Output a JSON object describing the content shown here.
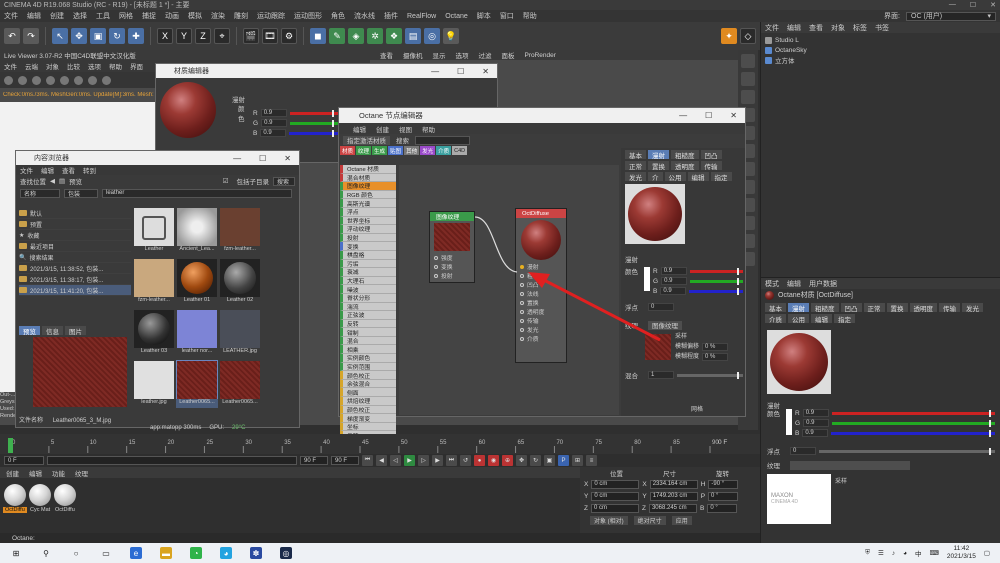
{
  "titlebar": {
    "title": "CINEMA 4D R19.068 Studio (RC - R19) - [未标题 1 *] - 主要"
  },
  "menu": {
    "items": [
      "文件",
      "编辑",
      "创建",
      "选择",
      "工具",
      "网格",
      "捕捉",
      "动画",
      "模拟",
      "渲染",
      "雕刻",
      "运动跟踪",
      "运动图形",
      "角色",
      "流水线",
      "插件",
      "RealFlow",
      "Octane",
      "脚本",
      "窗口",
      "帮助"
    ],
    "layout_label": "界面:",
    "layout_value": "OC (用户)"
  },
  "toolbar": {
    "axis_x": "X",
    "axis_y": "Y",
    "axis_z": "Z"
  },
  "object_manager": {
    "tabs": [
      "文件",
      "编辑",
      "查看",
      "对象",
      "标签",
      "书签"
    ],
    "items": [
      {
        "name": "Studio L",
        "color": "#9a9a9a"
      },
      {
        "name": "OctaneSky",
        "color": "#5a8ad0"
      },
      {
        "name": "立方体",
        "color": "#5a8ad0"
      }
    ]
  },
  "live_viewer": {
    "title": "Live Viewer 3.07-R2 中国C4D联盟中文汉化版",
    "menu": [
      "文件",
      "云端",
      "对象",
      "比较",
      "选项",
      "帮助",
      "界面"
    ],
    "status": "Check:0ms./3ms. MeshGen:0ms. Update[M]:3ms. Mesh:"
  },
  "viewport_menu": [
    "查看",
    "摄像机",
    "显示",
    "选项",
    "过滤",
    "面板",
    "ProRender"
  ],
  "side_labels": [
    "Out-...",
    "Greys...",
    "Used:...",
    "Render"
  ],
  "material_editor": {
    "title": "材质编辑器",
    "section": "漫射",
    "color_label": "颜色",
    "rows": [
      {
        "ch": "R",
        "val": "0.9"
      },
      {
        "ch": "G",
        "val": "0.9"
      },
      {
        "ch": "B",
        "val": "0.9"
      }
    ]
  },
  "content_browser": {
    "title": "内容浏览器",
    "menu": [
      "文件",
      "编辑",
      "查看",
      "转到"
    ],
    "find_label": "查找位置",
    "preview_label": "预览",
    "search_value": "leather",
    "filter_a": "名称",
    "filter_b": "包装",
    "include_sub": "包括子目录",
    "search_btn": "搜索",
    "tree": [
      "默认",
      "预置",
      "收藏",
      "最近项目",
      "搜索结果",
      "2021/3/15, 11:38:52, 包装...",
      "2021/3/15, 11:38:17, 包装...",
      "2021/3/15, 11:41:20, 包装..."
    ],
    "thumbs": [
      {
        "label": "Leather"
      },
      {
        "label": "Ancient_Lea..."
      },
      {
        "label": "fzm-leather..."
      },
      {
        "label": "fzm-leather..."
      },
      {
        "label": "Leather 01"
      },
      {
        "label": "Leather 02"
      },
      {
        "label": "Leather 03"
      },
      {
        "label": "leather nor..."
      },
      {
        "label": "LEATHER.jpg"
      },
      {
        "label": "leather.jpg"
      },
      {
        "label": "Leather0065..."
      },
      {
        "label": "Leather0065..."
      }
    ],
    "preview_tabs": [
      "预览",
      "信息",
      "图片"
    ],
    "file_name_label": "文件名称",
    "file_name": "Leather0065_3_M.jpg"
  },
  "octane_node": {
    "title": "Octane 节点编辑器",
    "menu": [
      "编辑",
      "创建",
      "视图",
      "帮助"
    ],
    "assign_btn": "指定激活材质",
    "search_label": "搜索",
    "color_tabs": [
      {
        "label": "材质",
        "color": "#c44"
      },
      {
        "label": "纹理",
        "color": "#3a9a4a"
      },
      {
        "label": "生成",
        "color": "#3a9a4a"
      },
      {
        "label": "贴图",
        "color": "#4a70c9"
      },
      {
        "label": "其他",
        "color": "#777"
      },
      {
        "label": "发光",
        "color": "#9a4ac9"
      },
      {
        "label": "介质",
        "color": "#3aa0a0"
      },
      {
        "label": "C4D",
        "color": "#aaa"
      }
    ],
    "node_list": [
      {
        "label": "Octane 材质",
        "kind": "red"
      },
      {
        "label": "混合材质",
        "kind": "red"
      },
      {
        "label": "图像纹理",
        "kind": "sel"
      },
      {
        "label": "RGB 颜色",
        "kind": "green"
      },
      {
        "label": "高斯光谱",
        "kind": "green"
      },
      {
        "label": "浮点",
        "kind": "green"
      },
      {
        "label": "世界坐标",
        "kind": "green"
      },
      {
        "label": "浮动纹理",
        "kind": "green"
      },
      {
        "label": "投射",
        "kind": "green"
      },
      {
        "label": "变换",
        "kind": "blue"
      },
      {
        "label": "棋盘格",
        "kind": "green"
      },
      {
        "label": "污垢",
        "kind": "green"
      },
      {
        "label": "衰减",
        "kind": "green"
      },
      {
        "label": "大理石",
        "kind": "green"
      },
      {
        "label": "噪波",
        "kind": "green"
      },
      {
        "label": "脊状分形",
        "kind": "green"
      },
      {
        "label": "湍流",
        "kind": "green"
      },
      {
        "label": "正弦波",
        "kind": "green"
      },
      {
        "label": "反转",
        "kind": "green"
      },
      {
        "label": "钳制",
        "kind": "green"
      },
      {
        "label": "混合",
        "kind": "green"
      },
      {
        "label": "相乘",
        "kind": "green"
      },
      {
        "label": "实例颜色",
        "kind": "green"
      },
      {
        "label": "实例范围",
        "kind": "green"
      },
      {
        "label": "颜色校正",
        "kind": "yellow"
      },
      {
        "label": "余弦混合",
        "kind": "yellow"
      },
      {
        "label": "侧面",
        "kind": "yellow"
      },
      {
        "label": "烘焙纹理",
        "kind": "yellow"
      },
      {
        "label": "颜色校正",
        "kind": "yellow"
      },
      {
        "label": "梯度渐变",
        "kind": "yellow"
      },
      {
        "label": "坐标",
        "kind": "yellow"
      },
      {
        "label": "反转",
        "kind": "yellow"
      }
    ],
    "image_node": {
      "title": "图像纹理",
      "pins": [
        "强度",
        "变换",
        "投射"
      ]
    },
    "diffuse_node": {
      "title": "OctDiffuse",
      "pins": [
        "漫射",
        "粗糙",
        "凹凸",
        "法线",
        "置换",
        "透明度",
        "传输",
        "发光",
        "介质"
      ]
    },
    "prop_tabs": [
      "基本",
      "漫射",
      "粗糙度",
      "凹凸",
      "正常",
      "置换",
      "透明度",
      "传输",
      "发光",
      "介",
      "公用",
      "编辑",
      "指定"
    ],
    "prop_section": "漫射",
    "prop_color": "颜色",
    "prop_rows": [
      {
        "ch": "R",
        "val": "0.9"
      },
      {
        "ch": "G",
        "val": "0.9"
      },
      {
        "ch": "B",
        "val": "0.9"
      }
    ],
    "float_label": "浮点",
    "float_val": "0",
    "tex_label": "纹理",
    "tex_btn": "图像纹理",
    "tex_sample": "采样",
    "blur_a_label": "模糊偏移",
    "blur_a_val": "0 %",
    "blur_b_label": "模糊程度",
    "blur_b_val": "0 %",
    "mix_label": "混合",
    "mix_val": "1",
    "grid_label": "网格"
  },
  "attributes": {
    "tabs": [
      "模式",
      "编辑",
      "用户数据"
    ],
    "mat_name": "Octane材质 [OctDiffuse]",
    "mat_tabs": [
      "基本",
      "漫射",
      "粗糙度",
      "凹凸",
      "正常",
      "置换",
      "透明度",
      "传输",
      "发光",
      "介质",
      "公用",
      "编辑",
      "指定"
    ],
    "section": "漫射",
    "color_label": "颜色",
    "rows": [
      {
        "ch": "R",
        "val": "0.9"
      },
      {
        "ch": "G",
        "val": "0.9"
      },
      {
        "ch": "B",
        "val": "0.9"
      }
    ],
    "float_label": "浮点",
    "float_val": "0",
    "tex_label": "纹理",
    "tex_sample": "采样",
    "brand_a": "MAXON",
    "brand_b": "CINEMA 4D"
  },
  "timeline": {
    "ticks": [
      "0",
      "5",
      "10",
      "15",
      "20",
      "25",
      "30",
      "35",
      "40",
      "45",
      "50",
      "55",
      "60",
      "65",
      "70",
      "75",
      "80",
      "85",
      "90"
    ],
    "current": "0 F",
    "start": "0 F",
    "end": "90 F",
    "end2": "90 F",
    "frame_right": "0 F",
    "gpu_label": "GPU:",
    "gpu_val": "29°C",
    "sys_info": "app:matopp 300ms"
  },
  "material_manager": {
    "menu": [
      "创建",
      "编辑",
      "功能",
      "纹理"
    ],
    "items": [
      {
        "label": "OctDiffu",
        "highlight": true
      },
      {
        "label": "Cyc Mat",
        "highlight": false
      },
      {
        "label": "OctDiffu",
        "highlight": false
      }
    ]
  },
  "coord_manager": {
    "h_pos": "位置",
    "h_size": "尺寸",
    "h_rot": "旋转",
    "rows": [
      {
        "a": "X",
        "av": "0 cm",
        "b": "X",
        "bv": "2334.164 cm",
        "c": "H",
        "cv": "-90 °"
      },
      {
        "a": "Y",
        "av": "0 cm",
        "b": "Y",
        "bv": "1749.203 cm",
        "c": "P",
        "cv": "0 °"
      },
      {
        "a": "Z",
        "av": "0 cm",
        "b": "Z",
        "bv": "3068.245 cm",
        "c": "B",
        "cv": "0 °"
      }
    ],
    "mode_a": "对象 (相对)",
    "mode_b": "绝对尺寸",
    "apply": "应用"
  },
  "status_line": "Octane:",
  "taskbar": {
    "lang": "中",
    "time": "11:42",
    "date": "2021/3/15"
  }
}
